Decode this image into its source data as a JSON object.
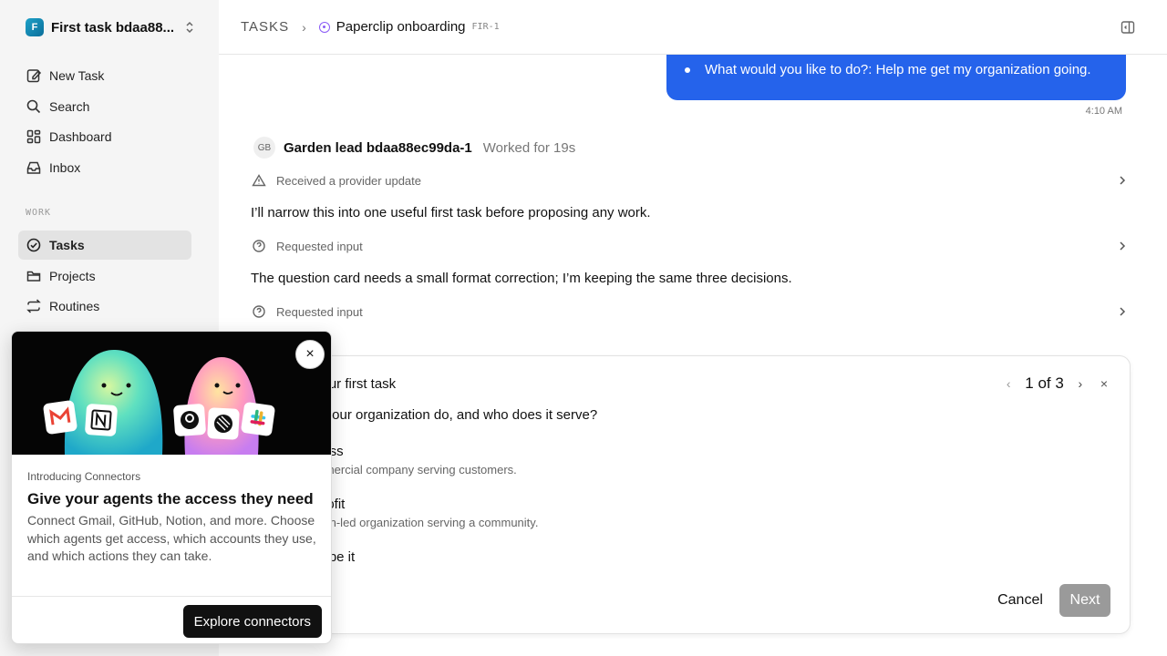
{
  "sidebar": {
    "workspace": {
      "logo": "F",
      "name": "First task bdaa88..."
    },
    "items": [
      {
        "label": "New Task",
        "icon": "edit-icon"
      },
      {
        "label": "Search",
        "icon": "search-icon"
      },
      {
        "label": "Dashboard",
        "icon": "dashboard-icon"
      },
      {
        "label": "Inbox",
        "icon": "inbox-icon"
      }
    ],
    "section_label": "WORK",
    "work_items": [
      {
        "label": "Tasks",
        "icon": "check-circle-icon",
        "active": true
      },
      {
        "label": "Projects",
        "icon": "folder-icon"
      },
      {
        "label": "Routines",
        "icon": "repeat-icon"
      }
    ]
  },
  "header": {
    "root": "TASKS",
    "separator": "›",
    "title": "Paperclip onboarding",
    "id": "FIR-1",
    "status_color": "#8b5cf6"
  },
  "thread": {
    "user_message": "What would you like to do?: Help me get my organization going.",
    "user_time": "4:10 AM",
    "agent": {
      "initials": "GB",
      "name": "Garden lead bdaa88ec99da-1",
      "worked": "Worked for 19s"
    },
    "events": [
      {
        "text": "Received a provider update",
        "icon": "alert-triangle-icon"
      },
      {
        "text": "Requested input",
        "icon": "help-circle-icon"
      },
      {
        "text": "Requested input",
        "icon": "help-circle-icon"
      }
    ],
    "messages": [
      "I’ll narrow this into one useful first task before proposing any work.",
      "The question card needs a small format correction; I’m keeping the same three decisions."
    ]
  },
  "question_card": {
    "title": "your first task",
    "pager": "1 of 3",
    "prev": "‹",
    "next_arrow": "›",
    "close": "×",
    "question": "s your organization do, and who does it serve?",
    "options": [
      {
        "label": "ness",
        "desc": "mmercial company serving customers."
      },
      {
        "label": "profit",
        "desc": "sion-led organization serving a community."
      },
      {
        "label": "cribe it",
        "desc": ""
      }
    ],
    "cancel_label": "Cancel",
    "next_label": "Next"
  },
  "promo": {
    "close": "×",
    "eyebrow": "Introducing Connectors",
    "title": "Give your agents the access they need",
    "body": "Connect Gmail, GitHub, Notion, and more. Choose which agents get access, which accounts they use, and which actions they can take.",
    "button": "Explore connectors",
    "logo_icons": [
      "gmail-icon",
      "notion-icon",
      "github-icon",
      "linear-icon",
      "slack-icon"
    ]
  },
  "colors": {
    "accent": "#2563eb",
    "sidebar_bg": "#f5f5f5",
    "disabled_button": "#9a9a9a"
  }
}
